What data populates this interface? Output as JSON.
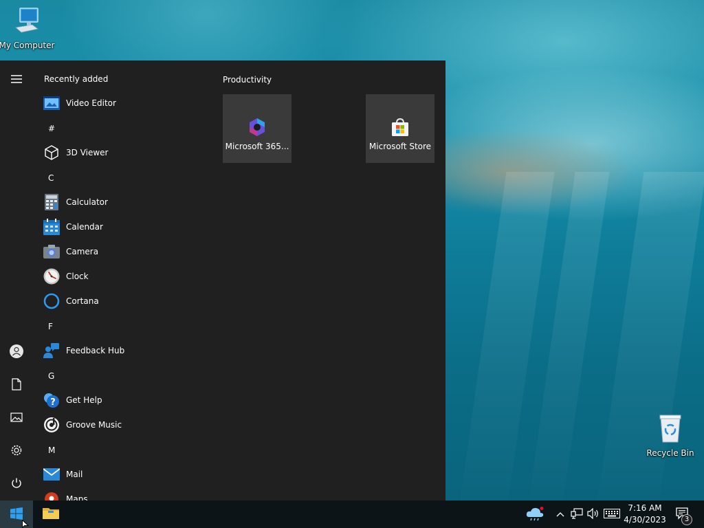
{
  "desktop": {
    "icons": [
      {
        "label": "My Computer",
        "icon": "computer-icon"
      },
      {
        "label": "Recycle Bin",
        "icon": "recycle-bin-icon"
      }
    ]
  },
  "start_menu": {
    "recently_added_header": "Recently added",
    "apps": [
      {
        "name": "Video Editor",
        "icon": "video-editor-icon"
      },
      {
        "name": "3D Viewer",
        "icon": "cube-icon"
      },
      {
        "name": "Calculator",
        "icon": "calculator-icon"
      },
      {
        "name": "Calendar",
        "icon": "calendar-icon"
      },
      {
        "name": "Camera",
        "icon": "camera-icon"
      },
      {
        "name": "Clock",
        "icon": "clock-icon"
      },
      {
        "name": "Cortana",
        "icon": "cortana-icon"
      },
      {
        "name": "Feedback Hub",
        "icon": "feedback-hub-icon"
      },
      {
        "name": "Get Help",
        "icon": "get-help-icon"
      },
      {
        "name": "Groove Music",
        "icon": "groove-music-icon"
      },
      {
        "name": "Mail",
        "icon": "mail-icon"
      },
      {
        "name": "Maps",
        "icon": "maps-icon"
      }
    ],
    "letters": [
      "#",
      "C",
      "F",
      "G",
      "M"
    ],
    "tile_group": {
      "title": "Productivity",
      "tiles": [
        {
          "label": "Microsoft 365...",
          "icon": "microsoft-365-icon"
        },
        {
          "label": "Microsoft Store",
          "icon": "microsoft-store-icon"
        }
      ]
    },
    "rail": [
      "hamburger-menu-icon",
      "user-icon",
      "documents-icon",
      "pictures-icon",
      "settings-icon",
      "power-icon"
    ]
  },
  "taskbar": {
    "time": "7:16 AM",
    "date": "4/30/2023",
    "notification_count": "3",
    "tray_icons": [
      "weather-icon",
      "chevron-up-icon",
      "network-icon",
      "volume-icon",
      "keyboard-icon",
      "action-center-icon"
    ],
    "pinned": [
      "windows-start-icon",
      "file-explorer-icon"
    ]
  },
  "colors": {
    "start_menu_bg": "#202020",
    "tile_bg": "#3a3a3a",
    "taskbar_bg": "#0c1418",
    "accent": "#0078d7"
  }
}
